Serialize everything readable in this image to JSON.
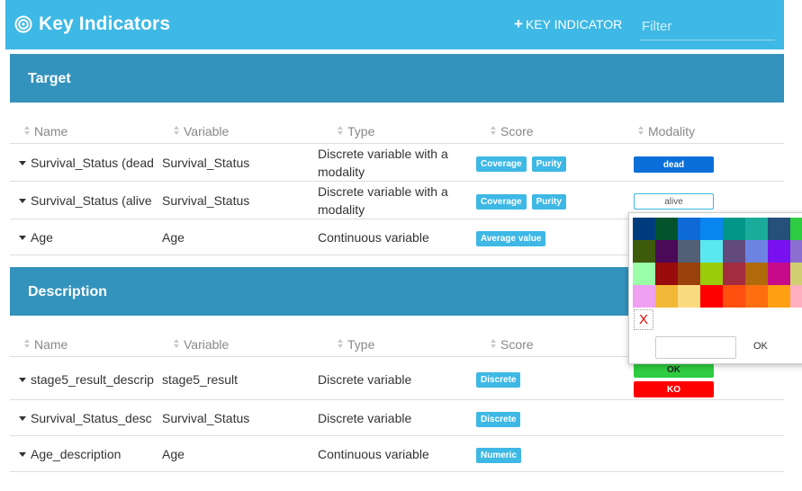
{
  "app": {
    "title": "Key Indicators",
    "add_label": "KEY INDICATOR",
    "filter_placeholder": "Filter"
  },
  "icons": {
    "logo": "target-icon",
    "add": "plus-icon",
    "sort": "sort-icon",
    "expand": "caret-down-icon"
  },
  "colors": {
    "topbar": "#3eb8e5",
    "section_header": "#3393bc",
    "badge": "#3eb8e5"
  },
  "columns": [
    "Name",
    "Variable",
    "Type",
    "Score",
    "Modality"
  ],
  "target": {
    "title": "Target",
    "rows": [
      {
        "name": "Survival_Status (dead",
        "variable": "Survival_Status",
        "type": "Discrete variable with a modality",
        "scores": [
          "Coverage",
          "Purity"
        ],
        "modalities": [
          {
            "label": "dead",
            "bg": "#0a6fd8",
            "fg": "#ffffff",
            "border": "#0a6fd8"
          }
        ]
      },
      {
        "name": "Survival_Status (alive",
        "variable": "Survival_Status",
        "type": "Discrete variable with a modality",
        "scores": [
          "Coverage",
          "Purity"
        ],
        "modalities": [
          {
            "label": "alive",
            "bg": "#ffffff",
            "fg": "#555555",
            "border": "#3eb8e5"
          }
        ]
      },
      {
        "name": "Age",
        "variable": "Age",
        "type": "Continuous variable",
        "scores": [
          "Average value"
        ],
        "modalities": []
      }
    ]
  },
  "description": {
    "title": "Description",
    "rows": [
      {
        "name": "stage5_result_descrip",
        "variable": "stage5_result",
        "type": "Discrete variable",
        "scores": [
          "Discrete"
        ],
        "modalities": [
          {
            "label": "OK",
            "bg": "#2ecc40",
            "fg": "#222222",
            "border": "#2ecc40"
          },
          {
            "label": "KO",
            "bg": "#ff0000",
            "fg": "#ffffff",
            "border": "#ff0000"
          }
        ]
      },
      {
        "name": "Survival_Status_desc",
        "variable": "Survival_Status",
        "type": "Discrete variable",
        "scores": [
          "Discrete"
        ],
        "modalities": []
      },
      {
        "name": "Age_description",
        "variable": "Age",
        "type": "Continuous variable",
        "scores": [
          "Numeric"
        ],
        "modalities": []
      }
    ]
  },
  "color_picker": {
    "swatches": [
      "#003c7d",
      "#04532d",
      "#0d6ad6",
      "#0a86f0",
      "#009688",
      "#1aab9b",
      "#24507a",
      "#2ecc40",
      "#3e5b0b",
      "#4b0a57",
      "#525f74",
      "#5ae8f0",
      "#624a7c",
      "#6d83e2",
      "#7810f0",
      "#8a6fd0",
      "#9affa8",
      "#9a0b0b",
      "#9a400a",
      "#9acc0a",
      "#a32d3e",
      "#b06a0a",
      "#c70a8a",
      "#d0d070",
      "#f0a0f0",
      "#f2b838",
      "#fadb80",
      "#ff0000",
      "#ff5010",
      "#ff6e10",
      "#ffa010",
      "#ffb0c0"
    ],
    "clear_label": "X",
    "hex_value": "",
    "ok_label": "OK"
  }
}
